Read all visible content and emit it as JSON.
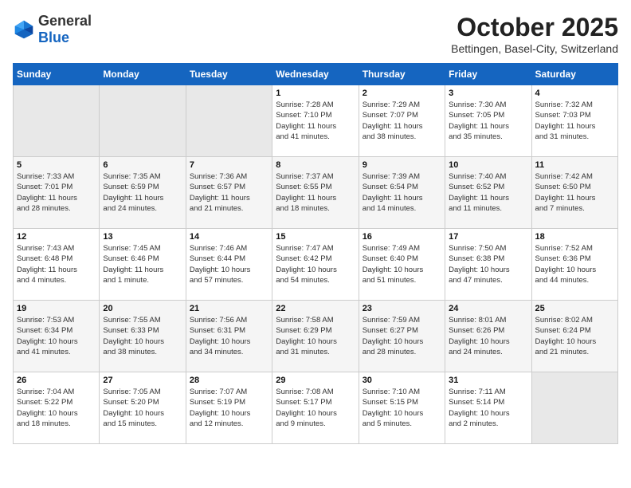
{
  "header": {
    "logo_general": "General",
    "logo_blue": "Blue",
    "month": "October 2025",
    "location": "Bettingen, Basel-City, Switzerland"
  },
  "weekdays": [
    "Sunday",
    "Monday",
    "Tuesday",
    "Wednesday",
    "Thursday",
    "Friday",
    "Saturday"
  ],
  "weeks": [
    [
      {
        "num": "",
        "info": "",
        "empty": true
      },
      {
        "num": "",
        "info": "",
        "empty": true
      },
      {
        "num": "",
        "info": "",
        "empty": true
      },
      {
        "num": "1",
        "info": "Sunrise: 7:28 AM\nSunset: 7:10 PM\nDaylight: 11 hours\nand 41 minutes."
      },
      {
        "num": "2",
        "info": "Sunrise: 7:29 AM\nSunset: 7:07 PM\nDaylight: 11 hours\nand 38 minutes."
      },
      {
        "num": "3",
        "info": "Sunrise: 7:30 AM\nSunset: 7:05 PM\nDaylight: 11 hours\nand 35 minutes."
      },
      {
        "num": "4",
        "info": "Sunrise: 7:32 AM\nSunset: 7:03 PM\nDaylight: 11 hours\nand 31 minutes."
      }
    ],
    [
      {
        "num": "5",
        "info": "Sunrise: 7:33 AM\nSunset: 7:01 PM\nDaylight: 11 hours\nand 28 minutes."
      },
      {
        "num": "6",
        "info": "Sunrise: 7:35 AM\nSunset: 6:59 PM\nDaylight: 11 hours\nand 24 minutes."
      },
      {
        "num": "7",
        "info": "Sunrise: 7:36 AM\nSunset: 6:57 PM\nDaylight: 11 hours\nand 21 minutes."
      },
      {
        "num": "8",
        "info": "Sunrise: 7:37 AM\nSunset: 6:55 PM\nDaylight: 11 hours\nand 18 minutes."
      },
      {
        "num": "9",
        "info": "Sunrise: 7:39 AM\nSunset: 6:54 PM\nDaylight: 11 hours\nand 14 minutes."
      },
      {
        "num": "10",
        "info": "Sunrise: 7:40 AM\nSunset: 6:52 PM\nDaylight: 11 hours\nand 11 minutes."
      },
      {
        "num": "11",
        "info": "Sunrise: 7:42 AM\nSunset: 6:50 PM\nDaylight: 11 hours\nand 7 minutes."
      }
    ],
    [
      {
        "num": "12",
        "info": "Sunrise: 7:43 AM\nSunset: 6:48 PM\nDaylight: 11 hours\nand 4 minutes."
      },
      {
        "num": "13",
        "info": "Sunrise: 7:45 AM\nSunset: 6:46 PM\nDaylight: 11 hours\nand 1 minute."
      },
      {
        "num": "14",
        "info": "Sunrise: 7:46 AM\nSunset: 6:44 PM\nDaylight: 10 hours\nand 57 minutes."
      },
      {
        "num": "15",
        "info": "Sunrise: 7:47 AM\nSunset: 6:42 PM\nDaylight: 10 hours\nand 54 minutes."
      },
      {
        "num": "16",
        "info": "Sunrise: 7:49 AM\nSunset: 6:40 PM\nDaylight: 10 hours\nand 51 minutes."
      },
      {
        "num": "17",
        "info": "Sunrise: 7:50 AM\nSunset: 6:38 PM\nDaylight: 10 hours\nand 47 minutes."
      },
      {
        "num": "18",
        "info": "Sunrise: 7:52 AM\nSunset: 6:36 PM\nDaylight: 10 hours\nand 44 minutes."
      }
    ],
    [
      {
        "num": "19",
        "info": "Sunrise: 7:53 AM\nSunset: 6:34 PM\nDaylight: 10 hours\nand 41 minutes."
      },
      {
        "num": "20",
        "info": "Sunrise: 7:55 AM\nSunset: 6:33 PM\nDaylight: 10 hours\nand 38 minutes."
      },
      {
        "num": "21",
        "info": "Sunrise: 7:56 AM\nSunset: 6:31 PM\nDaylight: 10 hours\nand 34 minutes."
      },
      {
        "num": "22",
        "info": "Sunrise: 7:58 AM\nSunset: 6:29 PM\nDaylight: 10 hours\nand 31 minutes."
      },
      {
        "num": "23",
        "info": "Sunrise: 7:59 AM\nSunset: 6:27 PM\nDaylight: 10 hours\nand 28 minutes."
      },
      {
        "num": "24",
        "info": "Sunrise: 8:01 AM\nSunset: 6:26 PM\nDaylight: 10 hours\nand 24 minutes."
      },
      {
        "num": "25",
        "info": "Sunrise: 8:02 AM\nSunset: 6:24 PM\nDaylight: 10 hours\nand 21 minutes."
      }
    ],
    [
      {
        "num": "26",
        "info": "Sunrise: 7:04 AM\nSunset: 5:22 PM\nDaylight: 10 hours\nand 18 minutes."
      },
      {
        "num": "27",
        "info": "Sunrise: 7:05 AM\nSunset: 5:20 PM\nDaylight: 10 hours\nand 15 minutes."
      },
      {
        "num": "28",
        "info": "Sunrise: 7:07 AM\nSunset: 5:19 PM\nDaylight: 10 hours\nand 12 minutes."
      },
      {
        "num": "29",
        "info": "Sunrise: 7:08 AM\nSunset: 5:17 PM\nDaylight: 10 hours\nand 9 minutes."
      },
      {
        "num": "30",
        "info": "Sunrise: 7:10 AM\nSunset: 5:15 PM\nDaylight: 10 hours\nand 5 minutes."
      },
      {
        "num": "31",
        "info": "Sunrise: 7:11 AM\nSunset: 5:14 PM\nDaylight: 10 hours\nand 2 minutes."
      },
      {
        "num": "",
        "info": "",
        "empty": true
      }
    ]
  ]
}
